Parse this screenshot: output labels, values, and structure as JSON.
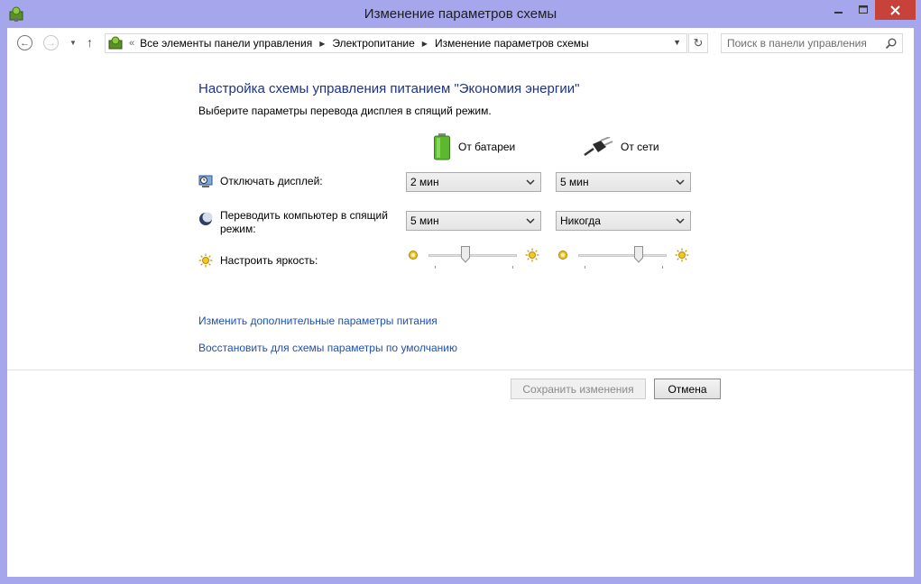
{
  "window": {
    "title": "Изменение параметров схемы",
    "accent": "#a5a6ec",
    "close_color": "#c7433a"
  },
  "nav": {
    "breadcrumb": [
      "Все элементы панели управления",
      "Электропитание",
      "Изменение параметров схемы"
    ],
    "search_placeholder": "Поиск в панели управления"
  },
  "main": {
    "heading": "Настройка схемы управления питанием \"Экономия энергии\"",
    "subtitle": "Выберите параметры перевода дисплея в спящий режим.",
    "columns": {
      "battery": "От батареи",
      "plugged": "От сети"
    },
    "rows": {
      "display": {
        "label": "Отключать дисплей:",
        "battery": "2 мин",
        "plugged": "5 мин"
      },
      "sleep": {
        "label": "Переводить компьютер в спящий режим:",
        "battery": "5 мин",
        "plugged": "Никогда"
      },
      "brightness": {
        "label": "Настроить яркость:",
        "battery_level": 0.42,
        "plugged_level": 0.68
      }
    }
  },
  "links": {
    "advanced": "Изменить дополнительные параметры питания",
    "restore": "Восстановить для схемы параметры по умолчанию"
  },
  "buttons": {
    "save": "Сохранить изменения",
    "cancel": "Отмена"
  }
}
